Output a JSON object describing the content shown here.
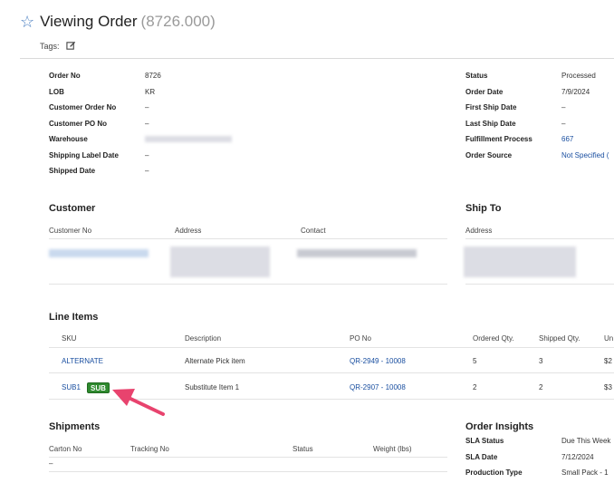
{
  "header": {
    "title": "Viewing Order",
    "order_ref": "(8726.000)",
    "tags_label": "Tags:"
  },
  "order_details": {
    "left": [
      {
        "label": "Order No",
        "value": "8726"
      },
      {
        "label": "LOB",
        "value": "KR"
      },
      {
        "label": "Customer Order No",
        "value": "–"
      },
      {
        "label": "Customer PO No",
        "value": "–"
      },
      {
        "label": "Warehouse",
        "value": ""
      },
      {
        "label": "Shipping Label Date",
        "value": "–"
      },
      {
        "label": "Shipped Date",
        "value": "–"
      }
    ],
    "right": [
      {
        "label": "Status",
        "value": "Processed"
      },
      {
        "label": "Order Date",
        "value": "7/9/2024"
      },
      {
        "label": "First Ship Date",
        "value": "–"
      },
      {
        "label": "Last Ship Date",
        "value": "–"
      },
      {
        "label": "Fulfillment Process",
        "value": "667"
      },
      {
        "label": "Order Source",
        "value": "Not Specified ("
      }
    ]
  },
  "customer": {
    "title": "Customer",
    "columns": [
      "Customer No",
      "Address",
      "Contact"
    ]
  },
  "ship_to": {
    "title": "Ship To",
    "columns": [
      "Address"
    ]
  },
  "line_items": {
    "title": "Line Items",
    "columns": [
      "SKU",
      "Description",
      "PO No",
      "Ordered Qty.",
      "Shipped Qty.",
      "Un"
    ],
    "rows": [
      {
        "sku": "ALTERNATE",
        "description": "Alternate Pick item",
        "po": "QR-2949 - 10008",
        "ordered": "5",
        "shipped": "3",
        "unit": "$2"
      },
      {
        "sku": "SUB1",
        "badge": "SUB",
        "description": "Substitute Item 1",
        "po": "QR-2907 - 10008",
        "ordered": "2",
        "shipped": "2",
        "unit": "$3"
      }
    ]
  },
  "shipments": {
    "title": "Shipments",
    "columns": [
      "Carton No",
      "Tracking No",
      "Status",
      "Weight (lbs)"
    ],
    "empty_value": "–"
  },
  "order_insights": {
    "title": "Order Insights",
    "rows": [
      {
        "label": "SLA Status",
        "value": "Due This Week"
      },
      {
        "label": "SLA Date",
        "value": "7/12/2024"
      },
      {
        "label": "Production Type",
        "value": "Small Pack - 1"
      }
    ]
  },
  "colors": {
    "link": "#1a4fa0",
    "badge": "#2f8a2f",
    "arrow": "#e8436e",
    "star": "#4a7fc1"
  }
}
